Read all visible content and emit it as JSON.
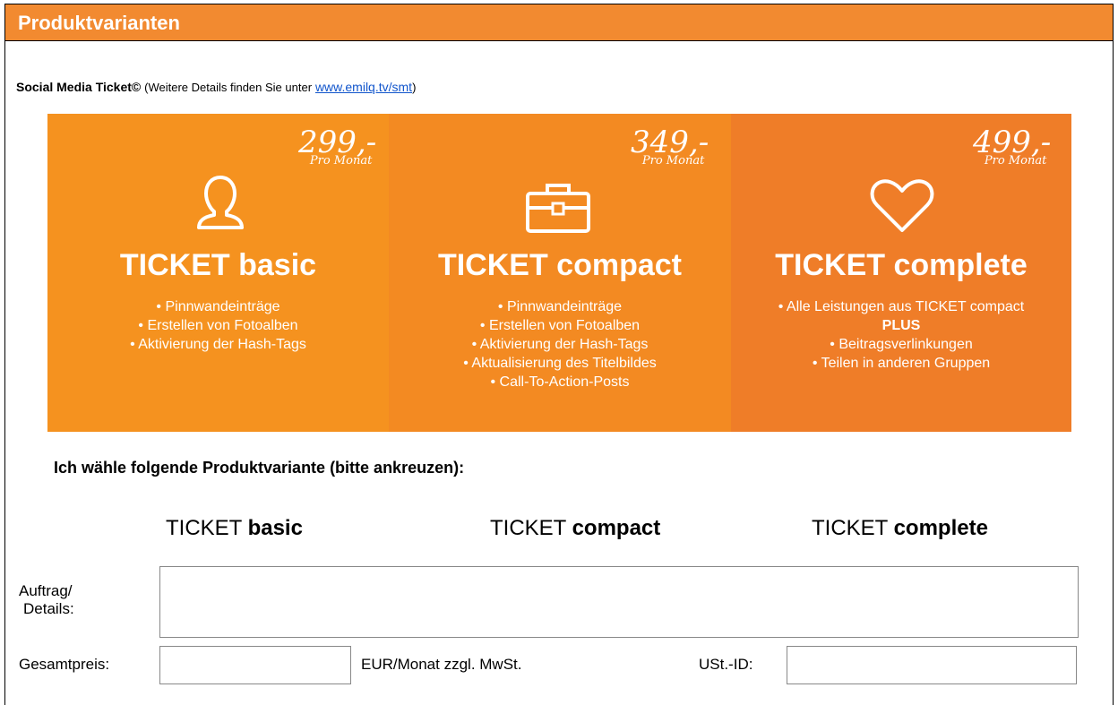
{
  "header": {
    "title": "Produktvarianten"
  },
  "intro": {
    "name": "Social Media Ticket©",
    "text": "(Weitere Details finden Sie unter",
    "link": "www.emilq.tv/smt",
    "close": ")"
  },
  "tickets": [
    {
      "price": "299,-",
      "period": "Pro Monat",
      "icon": "person-icon",
      "title": "TICKET basic",
      "features": [
        "• Pinnwandeinträge",
        "• Erstellen von Fotoalben",
        "• Aktivierung der Hash-Tags"
      ]
    },
    {
      "price": "349,-",
      "period": "Pro Monat",
      "icon": "briefcase-icon",
      "title": "TICKET compact",
      "features": [
        "• Pinnwandeinträge",
        "• Erstellen von Fotoalben",
        "• Aktivierung der Hash-Tags",
        "• Aktualisierung des Titelbildes",
        "• Call-To-Action-Posts"
      ]
    },
    {
      "price": "499,-",
      "period": "Pro Monat",
      "icon": "heart-icon",
      "title": "TICKET complete",
      "features": [
        "• Alle Leistungen aus TICKET compact",
        "PLUS",
        "• Beitragsverlinkungen",
        "• Teilen in anderen Gruppen"
      ]
    }
  ],
  "choice": {
    "prompt": "Ich wähle folgende Produktvariante (bitte ankreuzen):",
    "options": [
      {
        "prefix": "TICKET ",
        "name": "basic"
      },
      {
        "prefix": "TICKET ",
        "name": "compact"
      },
      {
        "prefix": "TICKET ",
        "name": "complete"
      }
    ]
  },
  "form": {
    "auftrag_label_1": "Auftrag/",
    "auftrag_label_2": "Details:",
    "auftrag_value": "",
    "price_label": "Gesamtpreis:",
    "price_value": "",
    "price_unit": "EUR/Monat zzgl. MwSt.",
    "ust_label": "USt.-ID:",
    "ust_value": ""
  },
  "colors": {
    "header": "#f28a30",
    "panel_basic": "#f5921f",
    "panel_compact": "#f38a22",
    "panel_complete": "#ef7d28",
    "link": "#1155cc"
  }
}
